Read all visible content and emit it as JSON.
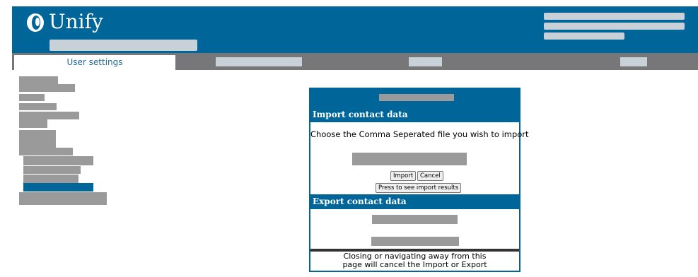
{
  "header": {
    "logo_text": "Unify"
  },
  "nav": {
    "active_tab_label": "User settings"
  },
  "dialog": {
    "import_title": "Import contact data",
    "import_prompt": "Choose the Comma Seperated file you wish to import",
    "import_button": "Import",
    "cancel_button": "Cancel",
    "results_button": "Press to see import results",
    "export_title": "Export contact data",
    "footer_line1": "Closing or navigating away from this",
    "footer_line2": "page will cancel the Import or Export"
  },
  "colors": {
    "brand_blue": "#006699",
    "nav_gray": "#77777a",
    "placeholder": "#9a9a9a"
  }
}
